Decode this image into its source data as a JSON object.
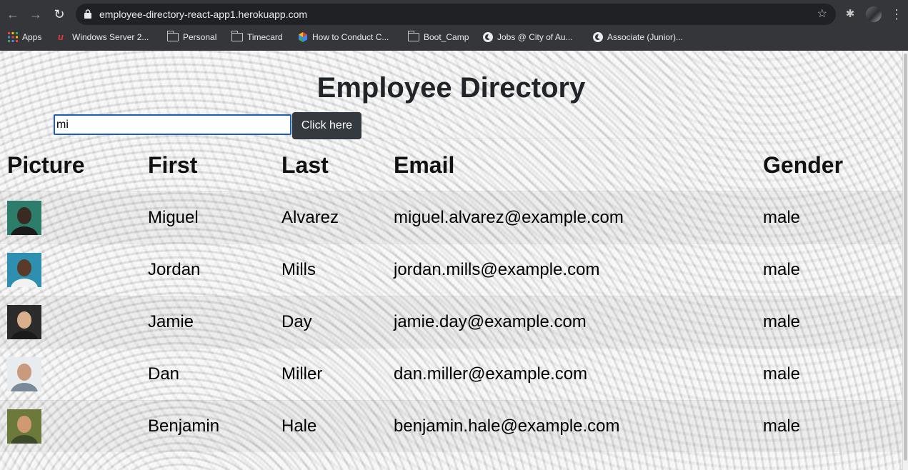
{
  "browser": {
    "url": "employee-directory-react-app1.herokuapp.com",
    "bookmarks": [
      {
        "label": "Apps",
        "icon": "apps-grid-icon"
      },
      {
        "label": "Windows Server 2...",
        "icon": "windows-server-icon"
      },
      {
        "label": "Personal",
        "icon": "folder-icon"
      },
      {
        "label": "Timecard",
        "icon": "folder-icon"
      },
      {
        "label": "How to Conduct C...",
        "icon": "hexagon-icon"
      },
      {
        "label": "Boot_Camp",
        "icon": "folder-icon"
      },
      {
        "label": "Jobs @ City of Au...",
        "icon": "globe-icon"
      },
      {
        "label": "Associate (Junior)...",
        "icon": "globe-icon"
      }
    ]
  },
  "page": {
    "title": "Employee Directory",
    "search": {
      "value": "mi",
      "button_label": "Click here"
    }
  },
  "table": {
    "headers": {
      "picture": "Picture",
      "first": "First",
      "last": "Last",
      "email": "Email",
      "gender": "Gender"
    },
    "rows": [
      {
        "first": "Miguel",
        "last": "Alvarez",
        "email": "miguel.alvarez@example.com",
        "gender": "male",
        "picture_colors": [
          "#2e7d6b",
          "#3a2a22",
          "#1b1b1b"
        ]
      },
      {
        "first": "Jordan",
        "last": "Mills",
        "email": "jordan.mills@example.com",
        "gender": "male",
        "picture_colors": [
          "#2f8fb0",
          "#5a3a28",
          "#f2f2f2"
        ]
      },
      {
        "first": "Jamie",
        "last": "Day",
        "email": "jamie.day@example.com",
        "gender": "male",
        "picture_colors": [
          "#2b2b2b",
          "#d9b08c",
          "#1a1a1a"
        ]
      },
      {
        "first": "Dan",
        "last": "Miller",
        "email": "dan.miller@example.com",
        "gender": "male",
        "picture_colors": [
          "#e8ecef",
          "#c99a7e",
          "#7a8a98"
        ]
      },
      {
        "first": "Benjamin",
        "last": "Hale",
        "email": "benjamin.hale@example.com",
        "gender": "male",
        "picture_colors": [
          "#6b7a3a",
          "#cf9a72",
          "#3d4a2a"
        ]
      }
    ]
  }
}
